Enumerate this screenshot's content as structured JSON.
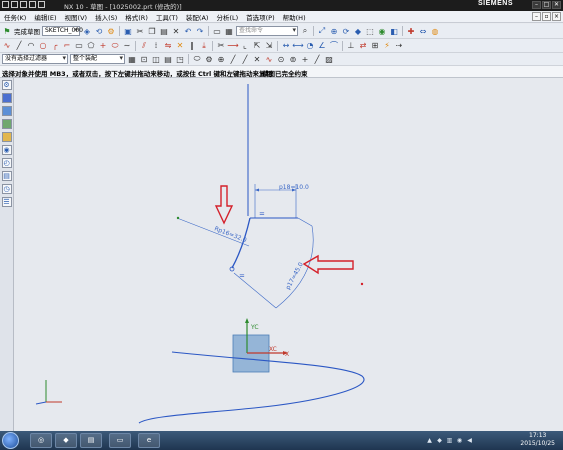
{
  "window": {
    "title": "NX 10 - 草图 - [1025002.prt (修改的)]",
    "brand": "SIEMENS",
    "buttons": {
      "min": "–",
      "max": "□",
      "close": "✕"
    }
  },
  "menubar": {
    "items": [
      "任务(K)",
      "编辑(E)",
      "视图(V)",
      "插入(S)",
      "格式(R)",
      "工具(T)",
      "装配(A)",
      "分析(L)",
      "首选项(P)",
      "帮助(H)"
    ]
  },
  "toolbar1": {
    "finish_sketch_label": "完成草图",
    "sketch_name": "SKETCH_000",
    "command_search_placeholder": "查找命令"
  },
  "toolbar3": {
    "selection_filter": "没有选择过滤器",
    "assembly_scope": "整个装配"
  },
  "status": {
    "prompt": "选择对象并使用 MB3，或者双击，按下左键并拖动来移动，或按住 Ctrl 键和左键拖动来复制",
    "sketch_status": "草图已完全约束"
  },
  "sketch": {
    "dimensions": {
      "phi18": "p18=10.0",
      "rp16": "Rp16=32.0",
      "p17": "p17=45.0"
    },
    "axis_labels": {
      "yc": "YC",
      "xc": "XC",
      "x": "X"
    }
  },
  "taskbar": {
    "time": "17:13",
    "date": "2015/10/25"
  },
  "colors": {
    "sketch_curve": "#2b57c4",
    "dimension": "#3a67c6",
    "annotation_arrow": "#d4202a",
    "csys_box": "#7aa3cf"
  }
}
